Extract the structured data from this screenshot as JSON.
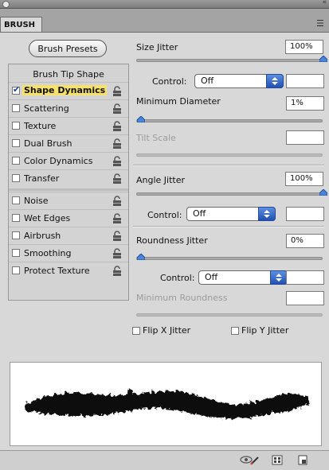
{
  "panel": {
    "tab_label": "BRUSH",
    "presets_button": "Brush Presets"
  },
  "left_list": {
    "header": "Brush Tip Shape",
    "groups": [
      [
        {
          "label": "Shape Dynamics",
          "checked": true,
          "selected": true
        },
        {
          "label": "Scattering",
          "checked": false
        },
        {
          "label": "Texture",
          "checked": false
        },
        {
          "label": "Dual Brush",
          "checked": false
        },
        {
          "label": "Color Dynamics",
          "checked": false
        },
        {
          "label": "Transfer",
          "checked": false
        }
      ],
      [
        {
          "label": "Noise",
          "checked": false
        },
        {
          "label": "Wet Edges",
          "checked": false
        },
        {
          "label": "Airbrush",
          "checked": false
        },
        {
          "label": "Smoothing",
          "checked": false
        },
        {
          "label": "Protect Texture",
          "checked": false
        }
      ]
    ]
  },
  "settings": {
    "size_jitter": {
      "label": "Size Jitter",
      "value": "100%",
      "slider": 1.0
    },
    "size_control": {
      "label": "Control:",
      "value": "Off"
    },
    "minimum_diameter": {
      "label": "Minimum Diameter",
      "value": "1%",
      "slider": 0.01
    },
    "tilt_scale": {
      "label": "Tilt Scale",
      "value": ""
    },
    "angle_jitter": {
      "label": "Angle Jitter",
      "value": "100%",
      "slider": 1.0
    },
    "angle_control": {
      "label": "Control:",
      "value": "Off"
    },
    "roundness_jitter": {
      "label": "Roundness Jitter",
      "value": "0%",
      "slider": 0.0
    },
    "roundness_control": {
      "label": "Control:",
      "value": "Off"
    },
    "minimum_roundness": {
      "label": "Minimum Roundness",
      "value": ""
    },
    "flip_x": {
      "label": "Flip X Jitter",
      "checked": false
    },
    "flip_y": {
      "label": "Flip Y Jitter",
      "checked": false
    }
  },
  "icons": {
    "titlebar": "close-dot-icon",
    "collapse": "double-arrow-icon",
    "panel_menu": "panel-menu-icon",
    "lock": "lock-icon",
    "eye_brush": "toggle-live-tip-icon",
    "grid": "brush-projection-icon",
    "new": "new-preset-icon"
  }
}
